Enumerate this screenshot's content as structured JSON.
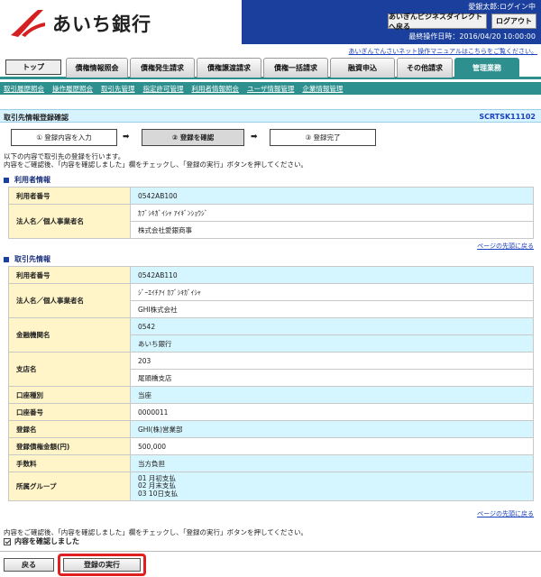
{
  "header": {
    "bank_name": "あいち銀行",
    "user_status": "愛銀太郎:ログイン中",
    "portal_button": "あいぎんビジネスダイレクトへ戻る",
    "logout_button": "ログアウト",
    "last_operation": "最終操作日時：2016/04/20 10:00:00",
    "manual_link": "あいぎんでんさいネット操作マニュアルはこちらをご覧ください。"
  },
  "tabs": [
    {
      "label": "トップ"
    },
    {
      "label": "債権情報照会"
    },
    {
      "label": "債権発生請求"
    },
    {
      "label": "債権譲渡請求"
    },
    {
      "label": "債権一括請求"
    },
    {
      "label": "融資申込"
    },
    {
      "label": "その他請求"
    },
    {
      "label": "管理業務"
    }
  ],
  "subnav": [
    "取引履歴照会",
    "操作履歴照会",
    "取引先管理",
    "指定許可管理",
    "利用者情報照会",
    "ユーザ情報管理",
    "企業情報管理"
  ],
  "page": {
    "title": "取引先情報登録確認",
    "screen_id": "SCRTSK11102"
  },
  "steps": [
    {
      "label": "① 登録内容を入力"
    },
    {
      "label": "② 登録を確認"
    },
    {
      "label": "③ 登録完了"
    }
  ],
  "step_arrow": "➡",
  "instructions": {
    "line1": "以下の内容で取引先の登録を行います。",
    "line2": "内容をご確認後、「内容を確認しました」欄をチェックし、「登録の実行」ボタンを押してください。"
  },
  "user_section": {
    "heading": "利用者情報",
    "user_number_label": "利用者番号",
    "user_number": "0542AB100",
    "name_label": "法人名／個人事業者名",
    "name_kana": "ｶﾌﾞｼｷｶﾞｲｼｬ ｱｲｷﾞﾝｼｮｳｼﾞ",
    "name": "株式会社愛銀商事"
  },
  "partner_section": {
    "heading": "取引先情報",
    "rows": {
      "user_number_label": "利用者番号",
      "user_number": "0542AB110",
      "name_label": "法人名／個人事業者名",
      "name_kana": "ｼﾞｰｴｲﾁｱｲ ｶﾌﾞｼｷｶﾞｲｼｬ",
      "name": "GHI株式会社",
      "bank_label": "金融機関名",
      "bank_code": "0542",
      "bank_name": "あいち銀行",
      "branch_label": "支店名",
      "branch_code": "203",
      "branch_name": "尾頭橋支店",
      "account_type_label": "口座種別",
      "account_type": "当座",
      "account_number_label": "口座番号",
      "account_number": "0000011",
      "registered_name_label": "登録名",
      "registered_name": "GHI(株)営業部",
      "limit_label": "登録債権金額(円)",
      "limit": "500,000",
      "fee_label": "手数料",
      "fee": "当方負担",
      "group_label": "所属グループ",
      "group_1": "01 月初支払",
      "group_2": "02 月末支払",
      "group_3": "03 10日支払"
    }
  },
  "page_top_link": "ページの先頭に戻る",
  "footer": {
    "instruction": "内容をご確認後、「内容を確認しました」欄をチェックし、「登録の実行」ボタンを押してください。",
    "confirm_label": "内容を確認しました",
    "back_button": "戻る",
    "execute_button": "登録の実行"
  },
  "colors": {
    "header_blue": "#1a3f9c",
    "teal": "#2e8f8f",
    "label_bg": "#fff5c8",
    "value_bg": "#d6f6ff",
    "highlight": "#e02020"
  }
}
